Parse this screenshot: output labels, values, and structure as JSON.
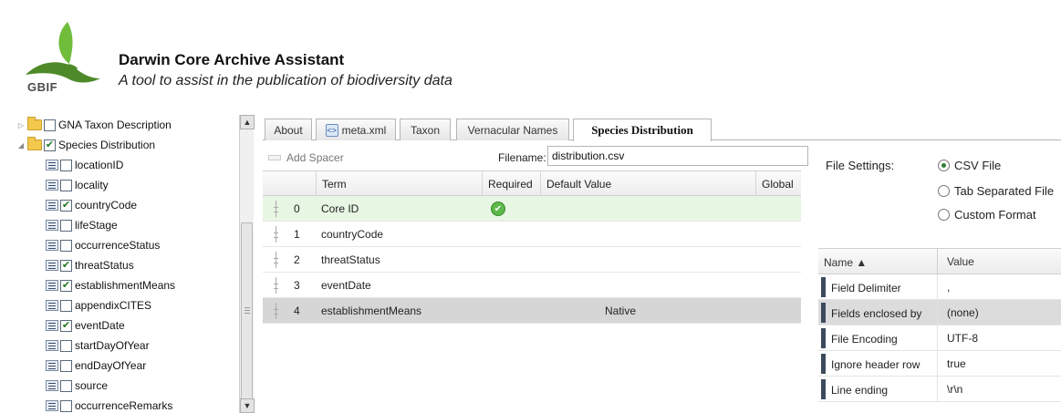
{
  "header": {
    "logo_text": "GBIF",
    "title": "Darwin Core Archive Assistant",
    "subtitle": "A tool to assist in the publication of biodiversity data"
  },
  "tree": {
    "items": [
      {
        "label": "GNA Taxon Description",
        "checked": false,
        "kind": "folder",
        "expanded": false
      },
      {
        "label": "Species Distribution",
        "checked": true,
        "kind": "folder",
        "expanded": true
      },
      {
        "label": "locationID",
        "checked": false,
        "kind": "field"
      },
      {
        "label": "locality",
        "checked": false,
        "kind": "field"
      },
      {
        "label": "countryCode",
        "checked": true,
        "kind": "field"
      },
      {
        "label": "lifeStage",
        "checked": false,
        "kind": "field"
      },
      {
        "label": "occurrenceStatus",
        "checked": false,
        "kind": "field"
      },
      {
        "label": "threatStatus",
        "checked": true,
        "kind": "field"
      },
      {
        "label": "establishmentMeans",
        "checked": true,
        "kind": "field"
      },
      {
        "label": "appendixCITES",
        "checked": false,
        "kind": "field"
      },
      {
        "label": "eventDate",
        "checked": true,
        "kind": "field"
      },
      {
        "label": "startDayOfYear",
        "checked": false,
        "kind": "field"
      },
      {
        "label": "endDayOfYear",
        "checked": false,
        "kind": "field"
      },
      {
        "label": "source",
        "checked": false,
        "kind": "field"
      },
      {
        "label": "occurrenceRemarks",
        "checked": false,
        "kind": "field"
      }
    ]
  },
  "tabs": [
    {
      "label": "About",
      "active": false
    },
    {
      "label": "meta.xml",
      "active": false,
      "icon": "xml-icon"
    },
    {
      "label": "Taxon",
      "active": false
    },
    {
      "label": "Vernacular Names",
      "active": false
    },
    {
      "label": "Species Distribution",
      "active": true
    }
  ],
  "toolbar": {
    "add_spacer_label": "Add Spacer",
    "filename_label": "Filename:",
    "filename_value": "distribution.csv"
  },
  "mapping": {
    "columns": [
      "Term",
      "Required",
      "Default Value",
      "Global"
    ],
    "rows": [
      {
        "index": "0",
        "term": "Core ID",
        "required": true,
        "default": ""
      },
      {
        "index": "1",
        "term": "countryCode",
        "required": false,
        "default": ""
      },
      {
        "index": "2",
        "term": "threatStatus",
        "required": false,
        "default": ""
      },
      {
        "index": "3",
        "term": "eventDate",
        "required": false,
        "default": ""
      },
      {
        "index": "4",
        "term": "establishmentMeans",
        "required": false,
        "default": "Native"
      }
    ]
  },
  "file_settings": {
    "label": "File Settings:",
    "options": [
      {
        "label": "CSV File",
        "selected": true
      },
      {
        "label": "Tab Separated File",
        "selected": false
      },
      {
        "label": "Custom Format",
        "selected": false
      }
    ]
  },
  "properties": {
    "header_name": "Name ▲",
    "header_value": "Value",
    "rows": [
      {
        "name": "Field Delimiter",
        "value": ","
      },
      {
        "name": "Fields enclosed by",
        "value": "(none)"
      },
      {
        "name": "File Encoding",
        "value": "UTF-8"
      },
      {
        "name": "Ignore header row",
        "value": "true"
      },
      {
        "name": "Line ending",
        "value": "\\r\\n"
      }
    ]
  },
  "colors": {
    "logo_green": "#6fbd3a",
    "logo_dark": "#4e8a2a",
    "core_row": "#e8f6e4",
    "selected_row": "#d6d6d6"
  }
}
